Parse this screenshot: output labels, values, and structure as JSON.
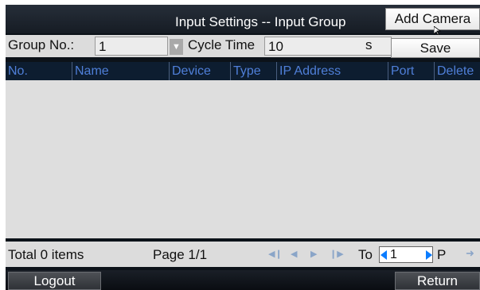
{
  "header": {
    "title": "Input Settings -- Input Group",
    "add_camera_label": "Add Camera"
  },
  "filter": {
    "group_label": "Group No.:",
    "group_value": "1",
    "cycle_label": "Cycle Time",
    "cycle_value": "10",
    "cycle_unit": "s",
    "save_label": "Save"
  },
  "table": {
    "columns": [
      "No.",
      "Name",
      "Device",
      "Type",
      "IP Address",
      "Port",
      "Delete"
    ],
    "rows": []
  },
  "footer": {
    "total": "Total 0 items",
    "page": "Page 1/1",
    "to_label": "To",
    "page_input": "1",
    "p_label": "P"
  },
  "bottom": {
    "logout_label": "Logout",
    "return_label": "Return"
  },
  "colors": {
    "header_text": "#4f7fd8",
    "panel_bg": "#0c1219",
    "nav_arrow": "#0a7cff"
  }
}
